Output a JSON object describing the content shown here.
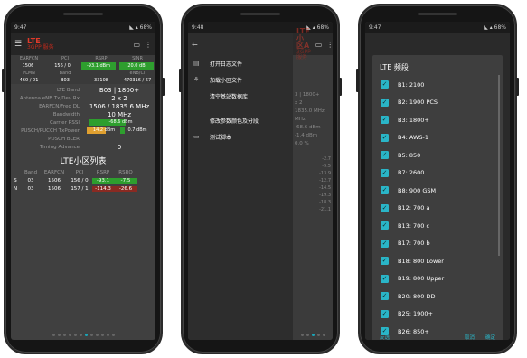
{
  "phone1": {
    "status": {
      "time": "9:47",
      "battery": "68%"
    },
    "appbar": {
      "title": "LTE",
      "subtitle": "3GPP 服务"
    },
    "grid1_headers": [
      "EARFCN",
      "PCI",
      "RSRP",
      "SINR"
    ],
    "grid1_values": [
      "1506",
      "156 / 0",
      "-93.1 dBm",
      "20.0 dB"
    ],
    "grid2_headers": [
      "PLMN",
      "Band",
      "",
      "eNB/CI"
    ],
    "grid2_values": [
      "460 / 01",
      "B03",
      "33108",
      "470316 / 67"
    ],
    "params": [
      {
        "k": "LTE Band",
        "v": "B03 | 1800+"
      },
      {
        "k": "Antenna eNB Tx/Dev Rx",
        "v": "2 x 2"
      },
      {
        "k": "EARFCN/Freq DL",
        "v": "1506 / 1835.6 MHz"
      },
      {
        "k": "Bandwidth",
        "v": "10 MHz"
      }
    ],
    "bars": {
      "rssi_label": "Carrier RSSI",
      "rssi_value": "-68.6 dBm",
      "rssi_level": 0.6,
      "pusch_label": "PUSCH/PUCCH TxPower",
      "pusch_a": "14.2 dBm",
      "pusch_a_level": 0.6,
      "pusch_b": "0.7 dBm",
      "pusch_b_level": 0.15
    },
    "params2": [
      {
        "k": "PDSCH BLER",
        "v": ""
      },
      {
        "k": "Timing Advance",
        "v": "0"
      }
    ],
    "cells_title": "LTE小区列表",
    "cells_headers": [
      "Band",
      "EARFCN",
      "PCI",
      "RSRP",
      "RSRQ"
    ],
    "cells": [
      {
        "tag": "S",
        "band": "03",
        "earfcn": "1506",
        "pci": "156 / 0",
        "rsrp": "-93.1",
        "rsrq": "-7.5"
      },
      {
        "tag": "N",
        "band": "03",
        "earfcn": "1506",
        "pci": "157 / 1",
        "rsrp": "-114.3",
        "rsrq": "-26.6"
      }
    ]
  },
  "phone2": {
    "status": {
      "time": "9:48",
      "battery": "68%"
    },
    "appbar": {
      "title": "LTE 小区A",
      "subtitle": "3GPP 服务"
    },
    "menu": [
      {
        "icon": "▤",
        "label": "打开日志文件"
      },
      {
        "icon": "⚘",
        "label": "加载小区文件"
      },
      {
        "icon": "",
        "label": "清空基站数据库"
      },
      {
        "icon": "",
        "label": "修改参数颜色及分段"
      },
      {
        "icon": "▭",
        "label": "测试脚本"
      }
    ],
    "behind_values": [
      "3 | 1800+",
      "x 2",
      "1835.0 MHz",
      "MHz",
      "-68.6 dBm",
      "-1.4 dBm",
      "0.0 %"
    ],
    "behind_cells": [
      "-2.7",
      "-9.5",
      "-13.9",
      "-12.7",
      "-14.5",
      "-19.3",
      "-18.3",
      "-21.1"
    ]
  },
  "phone3": {
    "status": {
      "time": "9:47",
      "battery": "68%"
    },
    "dialog_title": "LTE 频段",
    "bands": [
      "B1: 2100",
      "B2: 1900 PCS",
      "B3: 1800+",
      "B4: AWS-1",
      "B5: 850",
      "B7: 2600",
      "B8: 900 GSM",
      "B12: 700 a",
      "B13: 700 c",
      "B17: 700 b",
      "B18: 800 Lower",
      "B19: 800 Upper",
      "B20: 800 DD",
      "B25: 1900+",
      "B26: 850+"
    ],
    "buttons": {
      "select_all": "反选",
      "cancel": "取消",
      "ok": "确定"
    }
  },
  "colors": {
    "accent": "#2ab5c7",
    "green": "#2e9e2e",
    "orange": "#e0a030",
    "red": "#c03020",
    "title": "#e03a2a"
  }
}
